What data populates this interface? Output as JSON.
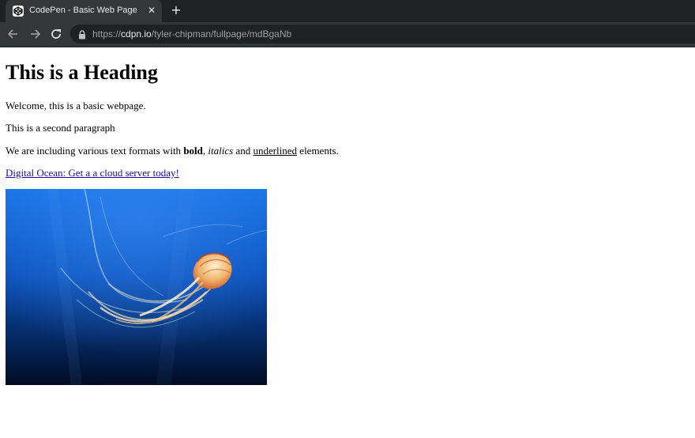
{
  "browser": {
    "tab": {
      "title": "CodePen - Basic Web Page",
      "favicon": "codepen-icon",
      "close_icon": "close-icon"
    },
    "new_tab_icon": "plus-icon",
    "nav": {
      "back_icon": "arrow-left-icon",
      "forward_icon": "arrow-right-icon",
      "reload_icon": "reload-icon"
    },
    "address": {
      "lock_icon": "lock-icon",
      "scheme": "https://",
      "host": "cdpn.io",
      "path": "/tyler-chipman/fullpage/mdBgaNb"
    },
    "colors": {
      "tabbar": "#202124",
      "toolbar": "#35363a"
    }
  },
  "page": {
    "heading": "This is a Heading",
    "paragraph1": "Welcome, this is a basic webpage.",
    "paragraph2": "This is a second paragraph",
    "paragraph3": {
      "prefix": "We are including various text formats with ",
      "bold": "bold",
      "sep1": ", ",
      "italic": "italics",
      "sep2": " and ",
      "underlined": "underlined",
      "suffix": " elements."
    },
    "link_text": "Digital Ocean: Get a a cloud server today!",
    "link_color": "#1a0dab",
    "image": {
      "subject": "jellyfish",
      "colors": {
        "top": "#1672e6",
        "bottom": "#010c22"
      }
    }
  }
}
